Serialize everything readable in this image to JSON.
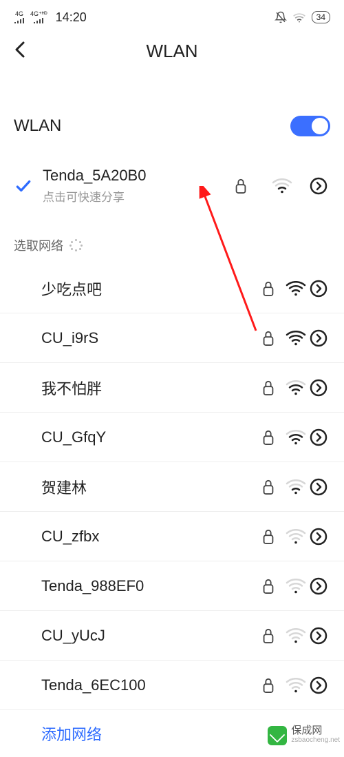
{
  "status": {
    "net1": "4G",
    "net2": "4G⁺ᴴᴰ",
    "time": "14:20",
    "battery": "34"
  },
  "header": {
    "title": "WLAN"
  },
  "toggle": {
    "label": "WLAN",
    "on": true
  },
  "connected": {
    "ssid": "Tenda_5A20B0",
    "hint": "点击可快速分享",
    "locked": true,
    "signal": 2
  },
  "section_label": "选取网络",
  "networks": [
    {
      "ssid": "少吃点吧",
      "locked": true,
      "signal": 4
    },
    {
      "ssid": "CU_i9rS",
      "locked": true,
      "signal": 4
    },
    {
      "ssid": "我不怕胖",
      "locked": true,
      "signal": 3
    },
    {
      "ssid": "CU_GfqY",
      "locked": true,
      "signal": 3
    },
    {
      "ssid": "贺建林",
      "locked": true,
      "signal": 2
    },
    {
      "ssid": "CU_zfbx",
      "locked": true,
      "signal": 1
    },
    {
      "ssid": "Tenda_988EF0",
      "locked": true,
      "signal": 1
    },
    {
      "ssid": "CU_yUcJ",
      "locked": true,
      "signal": 1
    },
    {
      "ssid": "Tenda_6EC100",
      "locked": true,
      "signal": 1
    }
  ],
  "add_network_label": "添加网络",
  "watermark": {
    "brand": "保成网",
    "domain": "zsbaocheng.net"
  }
}
